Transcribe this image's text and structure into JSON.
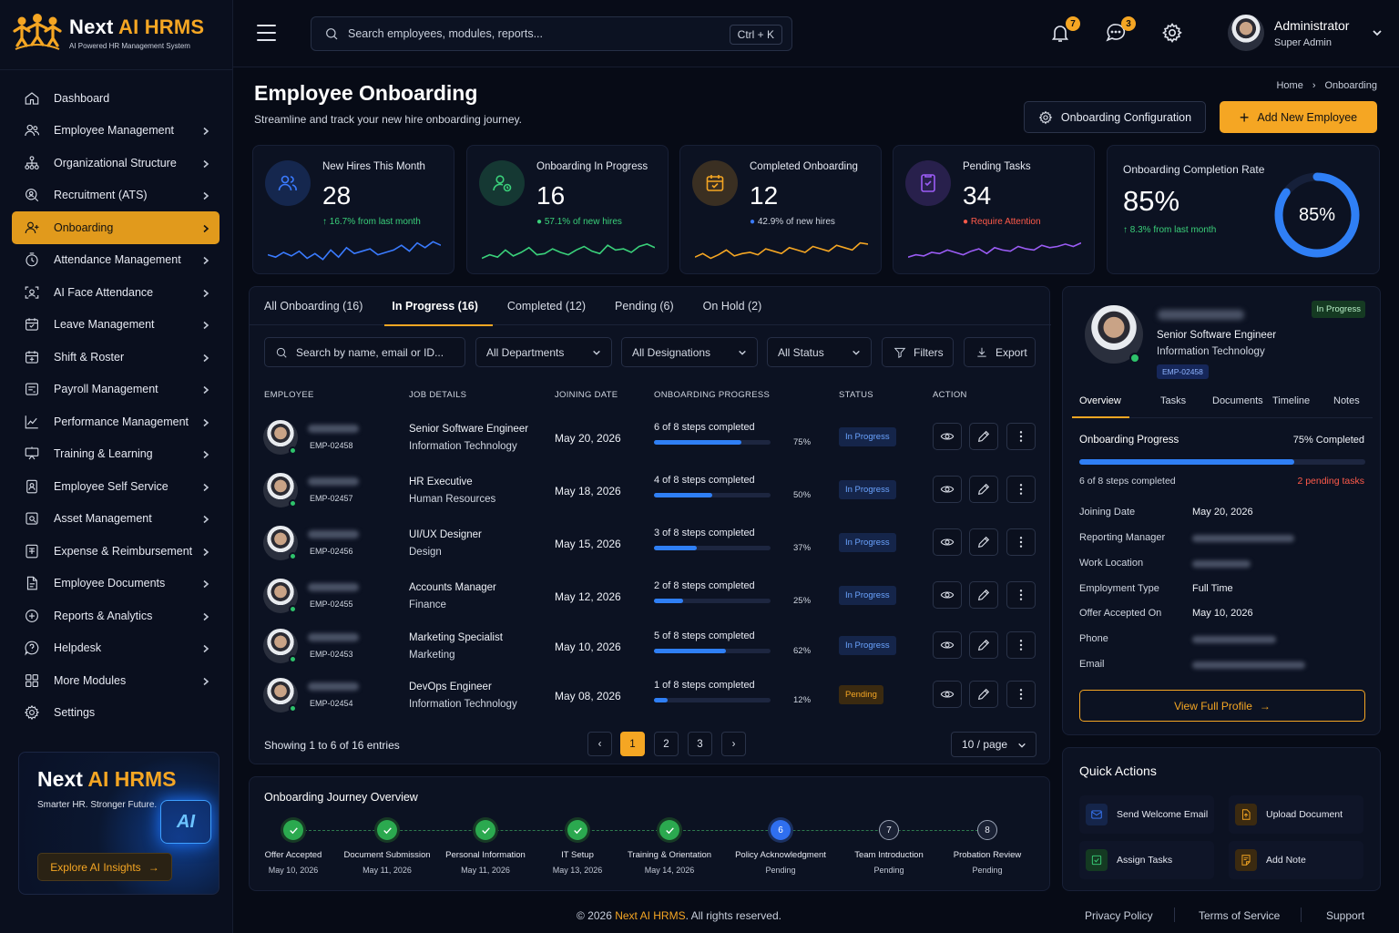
{
  "brand": {
    "name_a": "Next ",
    "name_b": "AI HRMS",
    "tagline": "AI Powered HR Management System"
  },
  "nav": [
    {
      "label": "Dashboard",
      "icon": "home-icon",
      "chevron": false
    },
    {
      "label": "Employee Management",
      "icon": "users-icon",
      "chevron": true
    },
    {
      "label": "Organizational Structure",
      "icon": "org-chart-icon",
      "chevron": true
    },
    {
      "label": "Recruitment (ATS)",
      "icon": "search-user-icon",
      "chevron": true
    },
    {
      "label": "Onboarding",
      "icon": "user-plus-icon",
      "chevron": true,
      "active": true
    },
    {
      "label": "Attendance Management",
      "icon": "clock-icon",
      "chevron": true
    },
    {
      "label": "AI Face Attendance",
      "icon": "face-scan-icon",
      "chevron": true
    },
    {
      "label": "Leave Management",
      "icon": "calendar-icon",
      "chevron": true
    },
    {
      "label": "Shift & Roster",
      "icon": "calendar-grid-icon",
      "chevron": true
    },
    {
      "label": "Payroll Management",
      "icon": "wallet-icon",
      "chevron": true
    },
    {
      "label": "Performance Management",
      "icon": "chart-line-icon",
      "chevron": true
    },
    {
      "label": "Training & Learning",
      "icon": "presentation-icon",
      "chevron": true
    },
    {
      "label": "Employee Self Service",
      "icon": "id-badge-icon",
      "chevron": true
    },
    {
      "label": "Asset Management",
      "icon": "asset-icon",
      "chevron": true
    },
    {
      "label": "Expense & Reimbursement",
      "icon": "receipt-icon",
      "chevron": true
    },
    {
      "label": "Employee Documents",
      "icon": "document-icon",
      "chevron": true
    },
    {
      "label": "Reports & Analytics",
      "icon": "plus-circle-icon",
      "chevron": true
    },
    {
      "label": "Helpdesk",
      "icon": "help-icon",
      "chevron": true
    },
    {
      "label": "More Modules",
      "icon": "grid-icon",
      "chevron": true
    },
    {
      "label": "Settings",
      "icon": "gear-icon",
      "chevron": false
    }
  ],
  "promo": {
    "title_a": "Next ",
    "title_b": "AI HRMS",
    "subtitle": "Smarter HR. Stronger Future.",
    "chip": "AI",
    "button": "Explore AI Insights"
  },
  "topbar": {
    "search_placeholder": "Search employees, modules, reports...",
    "shortcut": "Ctrl + K",
    "notifications": "7",
    "messages": "3",
    "user_name": "Administrator",
    "user_role": "Super Admin"
  },
  "header": {
    "title": "Employee Onboarding",
    "subtitle": "Streamline and track your new hire onboarding journey.",
    "crumb_home": "Home",
    "crumb_current": "Onboarding",
    "config_btn": "Onboarding Configuration",
    "add_btn": "Add New Employee"
  },
  "stats": [
    {
      "label": "New Hires This Month",
      "value": "28",
      "sub": "16.7% from last month",
      "sub_prefix": "↑ ",
      "color": "#3a7bff",
      "sub_color": "#3ad07a"
    },
    {
      "label": "Onboarding In Progress",
      "value": "16",
      "sub": "57.1% of new hires",
      "sub_prefix": "● ",
      "color": "#3ad07a",
      "sub_color": "#3ad07a"
    },
    {
      "label": "Completed Onboarding",
      "value": "12",
      "sub": "42.9% of new hires",
      "sub_prefix": "● ",
      "color": "#f5a623",
      "sub_color": "#cfd5e0"
    },
    {
      "label": "Pending Tasks",
      "value": "34",
      "sub": "Require Attention",
      "sub_prefix": "● ",
      "color": "#9b5cf5",
      "sub_color": "#ff5a4a"
    }
  ],
  "rate": {
    "label": "Onboarding Completion Rate",
    "value": "85%",
    "sub": "↑ 8.3% from last month",
    "percent": 85
  },
  "tabs": [
    "All Onboarding (16)",
    "In Progress (16)",
    "Completed (12)",
    "Pending (6)",
    "On Hold (2)"
  ],
  "filters": {
    "search_placeholder": "Search by name, email or ID...",
    "dept": "All Departments",
    "desig": "All Designations",
    "status": "All Status",
    "filters_btn": "Filters",
    "export_btn": "Export"
  },
  "columns": [
    "EMPLOYEE",
    "JOB DETAILS",
    "JOINING DATE",
    "ONBOARDING PROGRESS",
    "STATUS",
    "ACTION"
  ],
  "rows": [
    {
      "emp_id": "EMP-02458",
      "job": "Senior Software Engineer",
      "dept": "Information Technology",
      "date": "May 20, 2026",
      "steps": "6 of 8 steps completed",
      "pct": "75%",
      "progress": 0.75,
      "status": "In Progress",
      "kind": "prog"
    },
    {
      "emp_id": "EMP-02457",
      "job": "HR Executive",
      "dept": "Human Resources",
      "date": "May 18, 2026",
      "steps": "4 of 8 steps completed",
      "pct": "50%",
      "progress": 0.5,
      "status": "In Progress",
      "kind": "prog"
    },
    {
      "emp_id": "EMP-02456",
      "job": "UI/UX Designer",
      "dept": "Design",
      "date": "May 15, 2026",
      "steps": "3 of 8 steps completed",
      "pct": "37%",
      "progress": 0.37,
      "status": "In Progress",
      "kind": "prog"
    },
    {
      "emp_id": "EMP-02455",
      "job": "Accounts Manager",
      "dept": "Finance",
      "date": "May 12, 2026",
      "steps": "2 of 8 steps completed",
      "pct": "25%",
      "progress": 0.25,
      "status": "In Progress",
      "kind": "prog"
    },
    {
      "emp_id": "EMP-02453",
      "job": "Marketing Specialist",
      "dept": "Marketing",
      "date": "May 10, 2026",
      "steps": "5 of 8 steps completed",
      "pct": "62%",
      "progress": 0.62,
      "status": "In Progress",
      "kind": "prog"
    },
    {
      "emp_id": "EMP-02454",
      "job": "DevOps Engineer",
      "dept": "Information Technology",
      "date": "May 08, 2026",
      "steps": "1 of 8 steps completed",
      "pct": "12%",
      "progress": 0.12,
      "status": "Pending",
      "kind": "pend"
    }
  ],
  "pagination": {
    "info": "Showing 1 to 6 of 16 entries",
    "pages": [
      "1",
      "2",
      "3"
    ],
    "current": "1",
    "per_page": "10 / page"
  },
  "journey": {
    "title": "Onboarding Journey Overview",
    "steps": [
      {
        "name": "Offer Accepted",
        "date": "May 10, 2026",
        "state": "done",
        "num": ""
      },
      {
        "name": "Document Submission",
        "date": "May 11, 2026",
        "state": "done",
        "num": ""
      },
      {
        "name": "Personal Information",
        "date": "May 11, 2026",
        "state": "done",
        "num": ""
      },
      {
        "name": "IT Setup",
        "date": "May 13, 2026",
        "state": "done",
        "num": ""
      },
      {
        "name": "Training & Orientation",
        "date": "May 14, 2026",
        "state": "done",
        "num": ""
      },
      {
        "name": "Policy Acknowledgment",
        "date": "Pending",
        "state": "cur",
        "num": "6"
      },
      {
        "name": "Team Introduction",
        "date": "Pending",
        "state": "todo",
        "num": "7"
      },
      {
        "name": "Probation Review",
        "date": "Pending",
        "state": "todo",
        "num": "8"
      }
    ]
  },
  "profile": {
    "status": "In Progress",
    "job": "Senior Software Engineer",
    "dept": "Information Technology",
    "emp_id": "EMP-02458",
    "tabs": [
      "Overview",
      "Tasks",
      "Documents",
      "Timeline",
      "Notes"
    ],
    "section": "Onboarding Progress",
    "completed": "75% Completed",
    "progress": 0.75,
    "steps": "6 of 8 steps completed",
    "pending": "2 pending tasks",
    "fields": [
      {
        "k": "Joining Date",
        "v": "May 20, 2026"
      },
      {
        "k": "Reporting Manager",
        "v": ""
      },
      {
        "k": "Work Location",
        "v": ""
      },
      {
        "k": "Employment Type",
        "v": "Full Time"
      },
      {
        "k": "Offer Accepted On",
        "v": "May 10, 2026"
      },
      {
        "k": "Phone",
        "v": ""
      },
      {
        "k": "Email",
        "v": ""
      }
    ],
    "button": "View Full Profile"
  },
  "quick": {
    "title": "Quick Actions",
    "items": [
      {
        "label": "Send Welcome Email",
        "icon": "mail-icon",
        "color": "#3a7bff",
        "bg": "#15254a"
      },
      {
        "label": "Upload Document",
        "icon": "upload-doc-icon",
        "color": "#f5a623",
        "bg": "#3b2a10"
      },
      {
        "label": "Assign Tasks",
        "icon": "task-icon",
        "color": "#3ad07a",
        "bg": "#143a22"
      },
      {
        "label": "Add Note",
        "icon": "note-icon",
        "color": "#f5a623",
        "bg": "#3b2a10"
      }
    ]
  },
  "footer": {
    "copy_a": "© 2026 ",
    "copy_b": "Next AI HRMS",
    "copy_c": ". All rights reserved.",
    "privacy": "Privacy Policy",
    "terms": "Terms of Service",
    "support": "Support"
  }
}
